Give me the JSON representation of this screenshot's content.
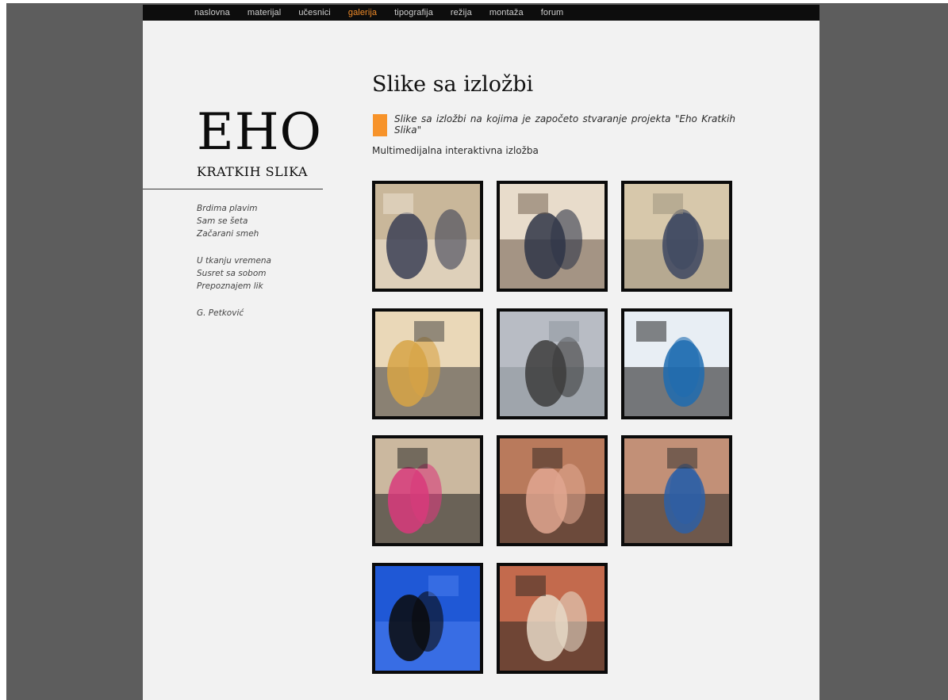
{
  "nav": {
    "items": [
      "naslovna",
      "materijal",
      "učesnici",
      "galerija",
      "tipografija",
      "režija",
      "montaža",
      "forum"
    ],
    "active": "galerija",
    "active_color": "#f28c28"
  },
  "logo": {
    "title": "EHO",
    "subtitle": "KRATKIH SLIKA"
  },
  "sidebar": {
    "group1": [
      "Brdima plavim",
      "Sam se šeta",
      "Začarani smeh"
    ],
    "group2": [
      "U tkanju vremena",
      "Susret sa sobom",
      "Prepoznajem lik"
    ],
    "group3": [
      "G. Petković"
    ]
  },
  "main": {
    "title": "Slike sa izložbi",
    "lead": "Slike sa izložbi na kojima je započeto stvaranje projekta \"Eho Kratkih Slika\"",
    "subtitle": "Multimedijalna interaktivna izložba",
    "accent_color": "#f7932a"
  },
  "gallery": {
    "photos": [
      {
        "name": "photo-visitors-computer",
        "palette": [
          "#c9b79a",
          "#3b3f55",
          "#efe6d6"
        ]
      },
      {
        "name": "photo-monitor-closeup",
        "palette": [
          "#e8dccb",
          "#2f3547",
          "#6b5a4a"
        ]
      },
      {
        "name": "photo-men-gallery",
        "palette": [
          "#d7c8ab",
          "#3d4760",
          "#9a8f7c"
        ]
      },
      {
        "name": "photo-seated-viewer",
        "palette": [
          "#ead8b8",
          "#d7a445",
          "#3a3a3a"
        ]
      },
      {
        "name": "photo-poster-text",
        "palette": [
          "#b8bcc4",
          "#3c3c3c",
          "#8a9199"
        ]
      },
      {
        "name": "photo-youtube-screen",
        "palette": [
          "#e8eef4",
          "#1e6cb0",
          "#141414"
        ]
      },
      {
        "name": "photo-couple-portrait",
        "palette": [
          "#cbb89f",
          "#d83a7b",
          "#1c1c1c"
        ]
      },
      {
        "name": "photo-projection-room",
        "palette": [
          "#b97a5c",
          "#e0a690",
          "#2d2320"
        ]
      },
      {
        "name": "photo-performers",
        "palette": [
          "#c29077",
          "#2d5fa6",
          "#2a2a2a"
        ]
      },
      {
        "name": "photo-blue-screen",
        "palette": [
          "#1f58d6",
          "#0a0a0a",
          "#4d7ff0"
        ]
      },
      {
        "name": "photo-audience-guitar",
        "palette": [
          "#c36a4d",
          "#e6d8c6",
          "#2a2622"
        ]
      }
    ]
  }
}
